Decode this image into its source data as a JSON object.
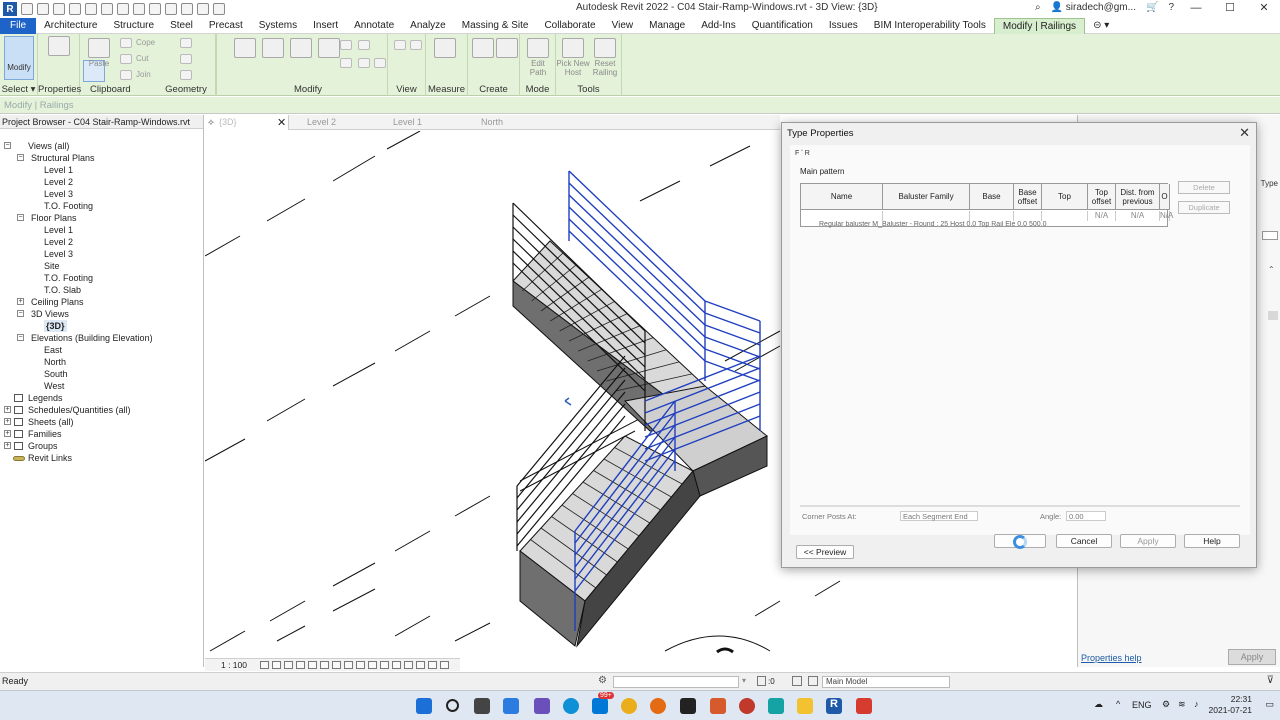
{
  "window": {
    "title": "Autodesk Revit 2022 - C04 Stair-Ramp-Windows.rvt - 3D View: {3D}",
    "user": "siradech@gm...",
    "logo": "R"
  },
  "menu_tabs": [
    "File",
    "Architecture",
    "Structure",
    "Steel",
    "Precast",
    "Systems",
    "Insert",
    "Annotate",
    "Analyze",
    "Massing & Site",
    "Collaborate",
    "View",
    "Manage",
    "Add-Ins",
    "Quantification",
    "Issues",
    "BIM Interoperability Tools",
    "Modify | Railings"
  ],
  "ribbon": {
    "modify_label": "Modify",
    "select_label": "Select ▾",
    "properties_label": "Properties",
    "clipboard_label": "Clipboard",
    "geometry_label": "Geometry",
    "modify_panel_label": "Modify",
    "view_label": "View",
    "measure_label": "Measure",
    "create_label": "Create",
    "mode_label": "Mode",
    "tools_label": "Tools",
    "paste": "Paste",
    "cope": "Cope",
    "cut": "Cut",
    "join": "Join",
    "edit_path": "Edit Path",
    "pick_new_host": "Pick New Host",
    "reset_railing": "Reset Railing"
  },
  "context_bar": "Modify | Railings",
  "project_browser": {
    "title": "Project Browser - C04 Stair-Ramp-Windows.rvt",
    "nodes": [
      {
        "label": "Views (all)",
        "depth": 0,
        "exp": "−"
      },
      {
        "label": "Structural Plans",
        "depth": 1,
        "exp": "−"
      },
      {
        "label": "Level 1",
        "depth": 2
      },
      {
        "label": "Level 2",
        "depth": 2
      },
      {
        "label": "Level 3",
        "depth": 2
      },
      {
        "label": "T.O. Footing",
        "depth": 2
      },
      {
        "label": "Floor Plans",
        "depth": 1,
        "exp": "−"
      },
      {
        "label": "Level 1",
        "depth": 2
      },
      {
        "label": "Level 2",
        "depth": 2
      },
      {
        "label": "Level 3",
        "depth": 2
      },
      {
        "label": "Site",
        "depth": 2
      },
      {
        "label": "T.O. Footing",
        "depth": 2
      },
      {
        "label": "T.O. Slab",
        "depth": 2
      },
      {
        "label": "Ceiling Plans",
        "depth": 1,
        "exp": "+"
      },
      {
        "label": "3D Views",
        "depth": 1,
        "exp": "−"
      },
      {
        "label": "{3D}",
        "depth": 2,
        "selected": true
      },
      {
        "label": "Elevations (Building Elevation)",
        "depth": 1,
        "exp": "−"
      },
      {
        "label": "East",
        "depth": 2
      },
      {
        "label": "North",
        "depth": 2
      },
      {
        "label": "South",
        "depth": 2
      },
      {
        "label": "West",
        "depth": 2
      },
      {
        "label": "Legends",
        "depth": 0,
        "icon": true
      },
      {
        "label": "Schedules/Quantities (all)",
        "depth": 0,
        "exp": "+",
        "icon": true
      },
      {
        "label": "Sheets (all)",
        "depth": 0,
        "exp": "+",
        "icon": true
      },
      {
        "label": "Families",
        "depth": 0,
        "exp": "+",
        "icon": true
      },
      {
        "label": "Groups",
        "depth": 0,
        "exp": "+",
        "icon": true
      },
      {
        "label": "Revit Links",
        "depth": 0,
        "link": true
      }
    ]
  },
  "view_tabs": [
    "{3D}",
    "Level 2",
    "Level 1",
    "North"
  ],
  "view_scale": "1 : 100",
  "type_properties": {
    "title": "Type Properties",
    "group_label": "Main pattern",
    "columns": [
      "Name",
      "Baluster Family",
      "Base",
      "Base offset",
      "Top",
      "Top offset",
      "Dist. from previous",
      "O"
    ],
    "row1": [
      "",
      "",
      "",
      "",
      "",
      "N/A",
      "N/A",
      "N/A"
    ],
    "row2_fragment": "Regular baluster   M_Baluster - Round : 25   Host   0.0   Top Rail Ele   0.0   500.0",
    "side_buttons": [
      "Delete",
      "Duplicate"
    ],
    "corner_posts_label": "Corner Posts At:",
    "corner_posts_value": "Each Segment End",
    "angle_label": "Angle:",
    "angle_value": "0.00",
    "faded_top": "F  ʻ   R",
    "buttons": {
      "preview": "<< Preview",
      "ok": "OK",
      "cancel": "Cancel",
      "apply": "Apply",
      "help": "Help"
    }
  },
  "right_panel": {
    "properties_help": "Properties help",
    "apply": "Apply",
    "type_label": "Type"
  },
  "status": {
    "ready": "Ready",
    "zero": ":0",
    "model": "Main Model"
  },
  "taskbar": {
    "lang": "ENG",
    "time": "22:31",
    "date": "2021-07-21",
    "badge": "99+"
  },
  "colors": {
    "ribbon": "#e4f2d9",
    "file_tab": "#1e64c8",
    "railing_blue": "#1f3fbf"
  }
}
